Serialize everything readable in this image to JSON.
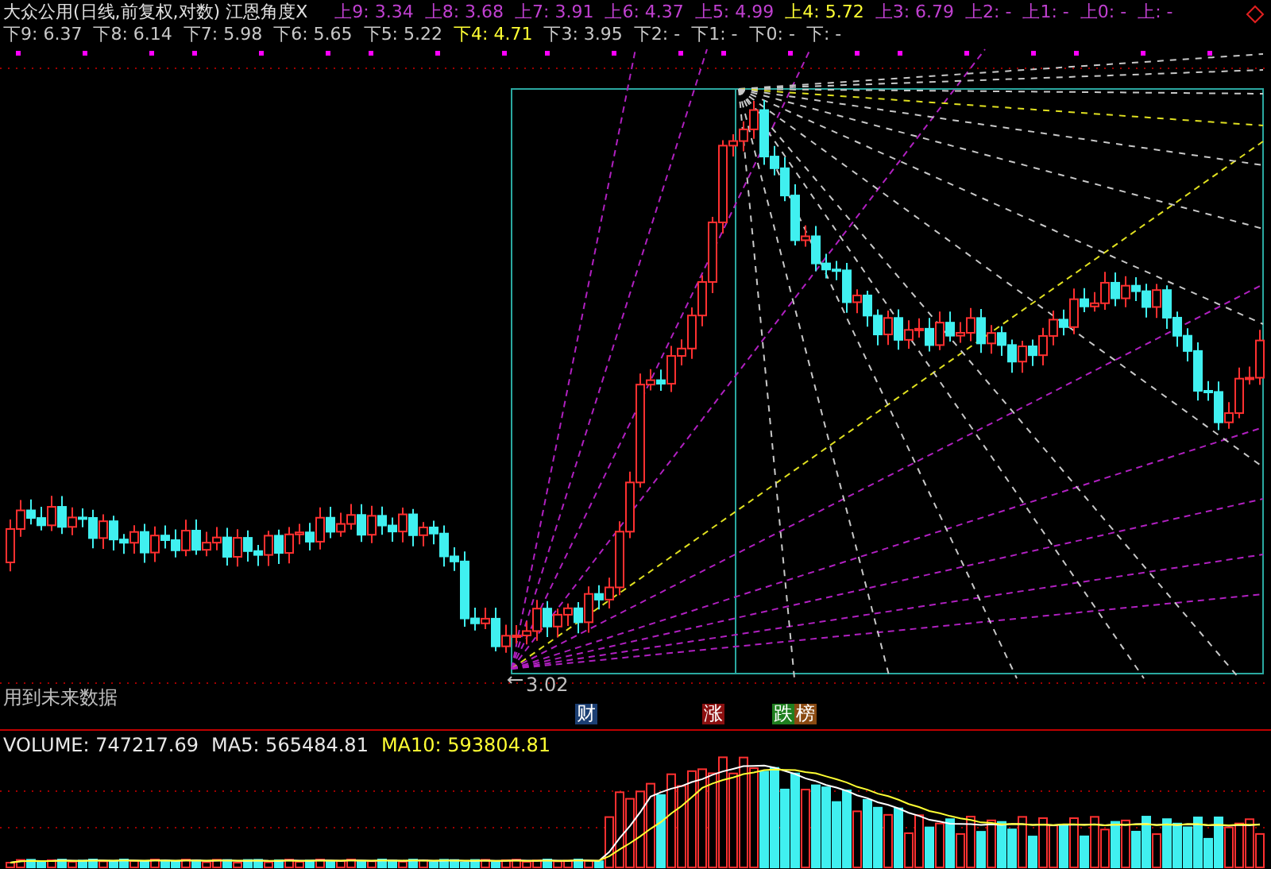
{
  "title": {
    "stock": "大众公用(日线,前复权,对数)",
    "indicator": "江恩角度X"
  },
  "levels": [
    {
      "text": "上9: 3.34",
      "highlighted": false,
      "kind": "upper"
    },
    {
      "text": "上8: 3.68",
      "highlighted": false,
      "kind": "upper"
    },
    {
      "text": "上7: 3.91",
      "highlighted": false,
      "kind": "upper"
    },
    {
      "text": "上6: 4.37",
      "highlighted": false,
      "kind": "upper"
    },
    {
      "text": "上5: 4.99",
      "highlighted": false,
      "kind": "upper"
    },
    {
      "text": "上4: 5.72",
      "highlighted": true,
      "kind": "upper"
    },
    {
      "text": "上3: 6.79",
      "highlighted": false,
      "kind": "upper"
    },
    {
      "text": "上2: -",
      "highlighted": false,
      "kind": "upper"
    },
    {
      "text": "上1: -",
      "highlighted": false,
      "kind": "upper"
    },
    {
      "text": "上0: -",
      "highlighted": false,
      "kind": "upper"
    },
    {
      "text": "上: -",
      "highlighted": false,
      "kind": "upper"
    },
    {
      "text": "下9: 6.37",
      "highlighted": false,
      "kind": "lower"
    },
    {
      "text": "下8: 6.14",
      "highlighted": false,
      "kind": "lower"
    },
    {
      "text": "下7: 5.98",
      "highlighted": false,
      "kind": "lower"
    },
    {
      "text": "下6: 5.65",
      "highlighted": false,
      "kind": "lower"
    },
    {
      "text": "下5: 5.22",
      "highlighted": false,
      "kind": "lower"
    },
    {
      "text": "下4: 4.71",
      "highlighted": true,
      "kind": "lower"
    },
    {
      "text": "下3: 3.95",
      "highlighted": false,
      "kind": "lower"
    },
    {
      "text": "下2: -",
      "highlighted": false,
      "kind": "lower"
    },
    {
      "text": "下1: -",
      "highlighted": false,
      "kind": "lower"
    },
    {
      "text": "下0: -",
      "highlighted": false,
      "kind": "lower"
    },
    {
      "text": "下: -",
      "highlighted": false,
      "kind": "lower"
    }
  ],
  "low_label": "3.02",
  "note": "用到未来数据",
  "badges": [
    {
      "text": "财",
      "color": "#1c3f73"
    },
    {
      "text": "涨",
      "color": "#8c1010"
    },
    {
      "text": "跌",
      "color": "#1f7f1f"
    },
    {
      "text": "榜",
      "color": "#8a4a12"
    }
  ],
  "volume": {
    "items": [
      {
        "text": "VOLUME: 747217.69",
        "color": "#e8e8e8"
      },
      {
        "text": "MA5: 565484.81",
        "color": "#e8e8e8"
      },
      {
        "text": "MA10: 593804.81",
        "color": "#ffff33"
      }
    ]
  }
}
